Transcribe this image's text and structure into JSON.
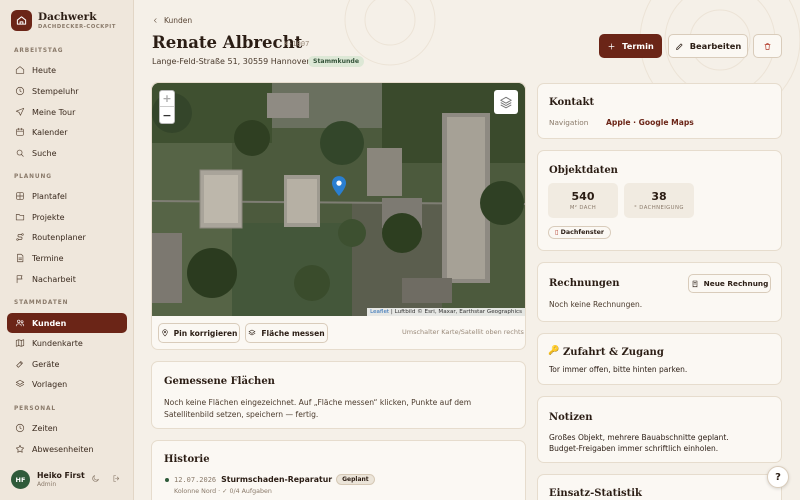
{
  "brand": {
    "title": "Dachwerk",
    "subtitle": "DACHDECKER-COCKPIT"
  },
  "sidebar": {
    "sections": [
      "ARBEITSTAG",
      "PLANUNG",
      "STAMMDATEN",
      "PERSONAL"
    ],
    "items": [
      {
        "label": "Heute",
        "icon": "home-icon"
      },
      {
        "label": "Stempeluhr",
        "icon": "clock-icon"
      },
      {
        "label": "Meine Tour",
        "icon": "send-icon"
      },
      {
        "label": "Kalender",
        "icon": "calendar-icon"
      },
      {
        "label": "Suche",
        "icon": "search-icon"
      },
      {
        "label": "Plantafel",
        "icon": "grid-icon"
      },
      {
        "label": "Projekte",
        "icon": "folder-icon"
      },
      {
        "label": "Routenplaner",
        "icon": "route-icon"
      },
      {
        "label": "Termine",
        "icon": "document-icon"
      },
      {
        "label": "Nacharbeit",
        "icon": "flag-icon"
      },
      {
        "label": "Kunden",
        "icon": "users-icon",
        "active": true
      },
      {
        "label": "Kundenkarte",
        "icon": "map-icon"
      },
      {
        "label": "Geräte",
        "icon": "hammer-icon"
      },
      {
        "label": "Vorlagen",
        "icon": "layers-icon"
      },
      {
        "label": "Zeiten",
        "icon": "clock-icon"
      },
      {
        "label": "Abwesenheiten",
        "icon": "star-icon"
      }
    ]
  },
  "user": {
    "initials": "HF",
    "name": "Heiko First",
    "role": "Admin"
  },
  "header": {
    "breadcrumb": "Kunden",
    "title": "Renate Albrecht",
    "customer_id": "K-1007",
    "address": "Lange-Feld-Straße 51, 30559 Hannover",
    "badge": "Stammkunde"
  },
  "actions": {
    "termin": "Termin",
    "bearbeiten": "Bearbeiten"
  },
  "map": {
    "attribution_link": "Leaflet",
    "attribution": "| Luftbild © Esri, Maxar, Earthstar Geographics",
    "zoom_in": "+",
    "zoom_out": "−",
    "btn_pin": "Pin korrigieren",
    "btn_area": "Fläche messen",
    "hint": "Umschalter Karte/Satellit oben rechts"
  },
  "areas": {
    "title": "Gemessene Flächen",
    "text": "Noch keine Flächen eingezeichnet. Auf „Fläche messen“ klicken, Punkte auf dem Satellitenbild setzen, speichern — fertig."
  },
  "history": {
    "title": "Historie",
    "entry": {
      "date": "12.07.2026",
      "title": "Sturmschaden-Reparatur",
      "status": "Geplant",
      "meta": "Kolonne Nord · ✓ 0/4 Aufgaben"
    }
  },
  "contact": {
    "title": "Kontakt",
    "nav_label": "Navigation",
    "nav_value": "Apple · Google Maps"
  },
  "object": {
    "title": "Objektdaten",
    "area_value": "540",
    "area_label": "M² DACH",
    "pitch_value": "38",
    "pitch_label": "° DACHNEIGUNG",
    "chip": "Dachfenster"
  },
  "invoices": {
    "title": "Rechnungen",
    "button": "Neue Rechnung",
    "empty": "Noch keine Rechnungen."
  },
  "access": {
    "title": "Zufahrt & Zugang",
    "text": "Tor immer offen, bitte hinten parken."
  },
  "notes": {
    "title": "Notizen",
    "line1": "Großes Objekt, mehrere Bauabschnitte geplant.",
    "line2": "Budget-Freigaben immer schriftlich einholen."
  },
  "stats": {
    "title": "Einsatz-Statistik"
  },
  "help": "?",
  "colors": {
    "primary": "#6b2517",
    "background": "#f5f0e8",
    "badge_green": "#dde8d6"
  }
}
